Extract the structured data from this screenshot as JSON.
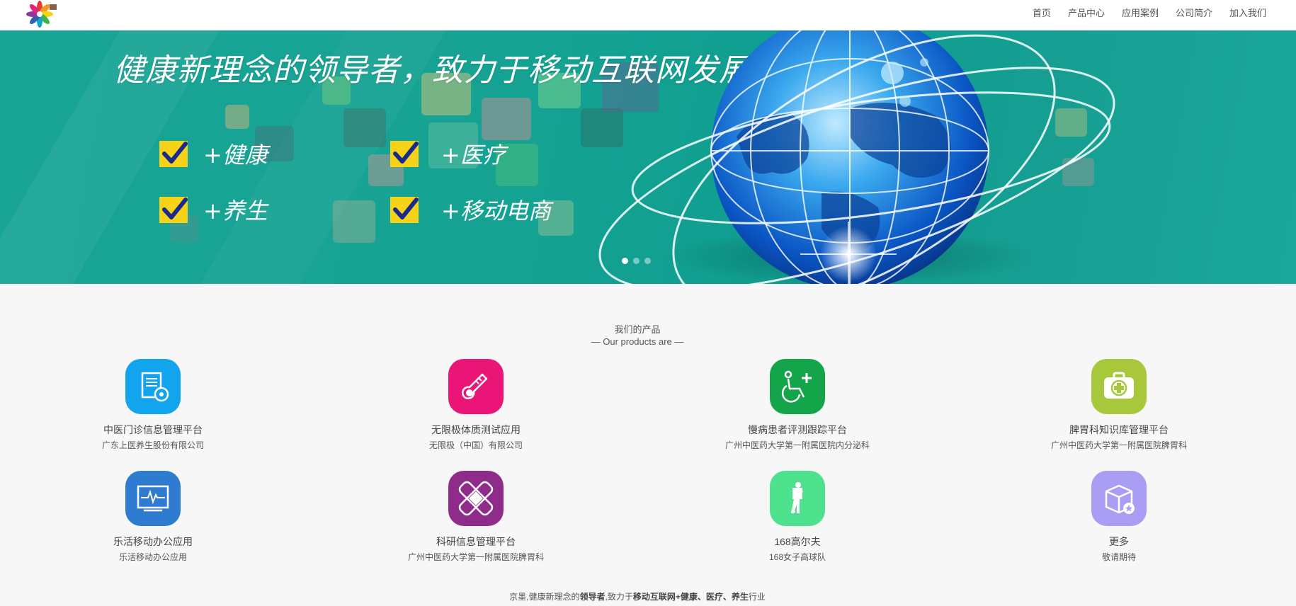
{
  "nav": {
    "items": [
      "首页",
      "产品中心",
      "应用案例",
      "公司简介",
      "加入我们"
    ]
  },
  "banner": {
    "headline": "健康新理念的领导者，致力于移动互联网发展",
    "features": [
      "+健康",
      "+医疗",
      "+养生",
      "+移动电商"
    ],
    "slide_count": 3,
    "active_slide": 0
  },
  "products": {
    "title": "我们的产品",
    "subtitle": "— Our products are —",
    "items": [
      {
        "name": "中医门诊信息管理平台",
        "company": "广东上医养生股份有限公司",
        "color": "#12a4ec",
        "icon": "document-stamp-icon"
      },
      {
        "name": "无限极体质测试应用",
        "company": "无限极（中国）有限公司",
        "color": "#ea1577",
        "icon": "thermometer-icon"
      },
      {
        "name": "慢病患者评测跟踪平台",
        "company": "广州中医药大学第一附属医院内分泌科",
        "color": "#14a54b",
        "icon": "wheelchair-plus-icon"
      },
      {
        "name": "脾胃科知识库管理平台",
        "company": "广州中医药大学第一附属医院脾胃科",
        "color": "#a7c83a",
        "icon": "medical-kit-icon"
      },
      {
        "name": "乐活移动办公应用",
        "company": "乐活移动办公应用",
        "color": "#2f7bd0",
        "icon": "monitor-pulse-icon"
      },
      {
        "name": "科研信息管理平台",
        "company": "广州中医药大学第一附属医院脾胃科",
        "color": "#8f2b8a",
        "icon": "bandage-icon"
      },
      {
        "name": "168高尔夫",
        "company": "168女子高球队",
        "color": "#4ee28e",
        "icon": "golfer-icon"
      },
      {
        "name": "更多",
        "company": "敬请期待",
        "color": "#a99ef3",
        "icon": "box-star-icon"
      }
    ]
  },
  "footer": {
    "parts": [
      "京墨,健康新理念的",
      "领导者",
      ",致力于",
      "移动互联网+健康、医疗、养生",
      "行业"
    ]
  },
  "colors": {
    "banner": "#16a393",
    "check": "#f6d318"
  }
}
